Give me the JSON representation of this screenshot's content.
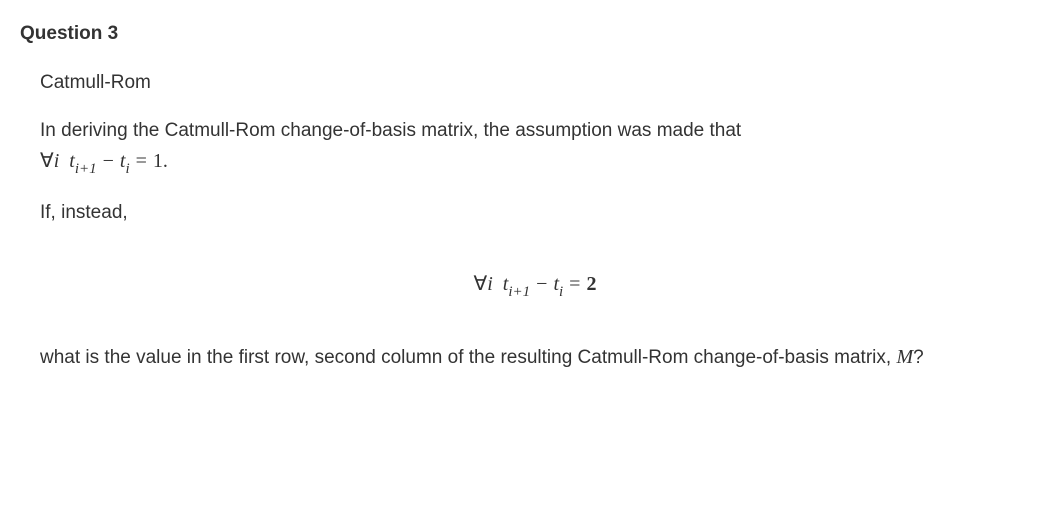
{
  "question": {
    "title": "Question 3",
    "subtitle": "Catmull-Rom",
    "para1_text": "In deriving the Catmull-Rom change-of-basis matrix, the assumption was made that ",
    "para2_text": "If, instead,",
    "para3a": "what is the value in the first row, second column of the resulting Catmull-Rom change-of-basis matrix, ",
    "para3_m": "M",
    "para3b": "?"
  },
  "math": {
    "inline1": {
      "forall": "∀",
      "var_i": "i",
      "var_t": "t",
      "sub1": "i+1",
      "minus": "−",
      "sub2": "i",
      "eq": "=",
      "val": "1",
      "end": "."
    },
    "display1": {
      "forall": "∀",
      "var_i": "i",
      "var_t": "t",
      "sub1": "i+1",
      "minus": "−",
      "sub2": "i",
      "eq": "=",
      "val": "2"
    }
  }
}
